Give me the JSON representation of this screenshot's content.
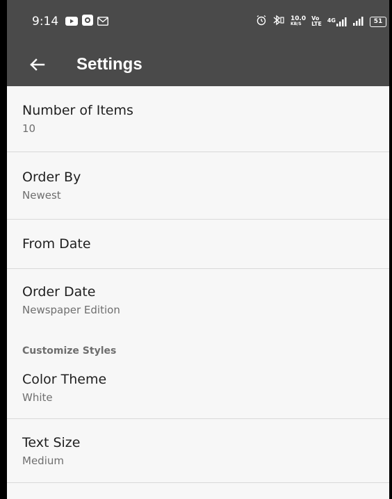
{
  "status_bar": {
    "time": "9:14",
    "battery": "51",
    "net_speed_top": "10.0",
    "net_speed_bottom": "KB/S",
    "volte_top": "Vo",
    "volte_bottom": "LTE",
    "network_label": "4G",
    "icons": [
      "youtube-icon",
      "camera-icon",
      "gmail-icon",
      "alarm-icon",
      "bluetooth-icon",
      "signal-icon",
      "battery-icon"
    ]
  },
  "app_bar": {
    "title": "Settings",
    "back_icon": "arrow-left-icon"
  },
  "preferences": [
    {
      "title": "Number of Items",
      "summary": "10"
    },
    {
      "title": "Order By",
      "summary": "Newest"
    },
    {
      "title": "From Date",
      "summary": ""
    },
    {
      "title": "Order Date",
      "summary": "Newspaper Edition"
    }
  ],
  "category": {
    "label": "Customize Styles"
  },
  "style_preferences": [
    {
      "title": "Color Theme",
      "summary": "White"
    },
    {
      "title": "Text Size",
      "summary": "Medium"
    }
  ],
  "colors": {
    "app_bar": "#4a4a4a",
    "background": "#f7f7f7",
    "title_text": "#1f1f1f",
    "summary_text": "#6e6e6e",
    "divider": "#d9d9d9"
  }
}
